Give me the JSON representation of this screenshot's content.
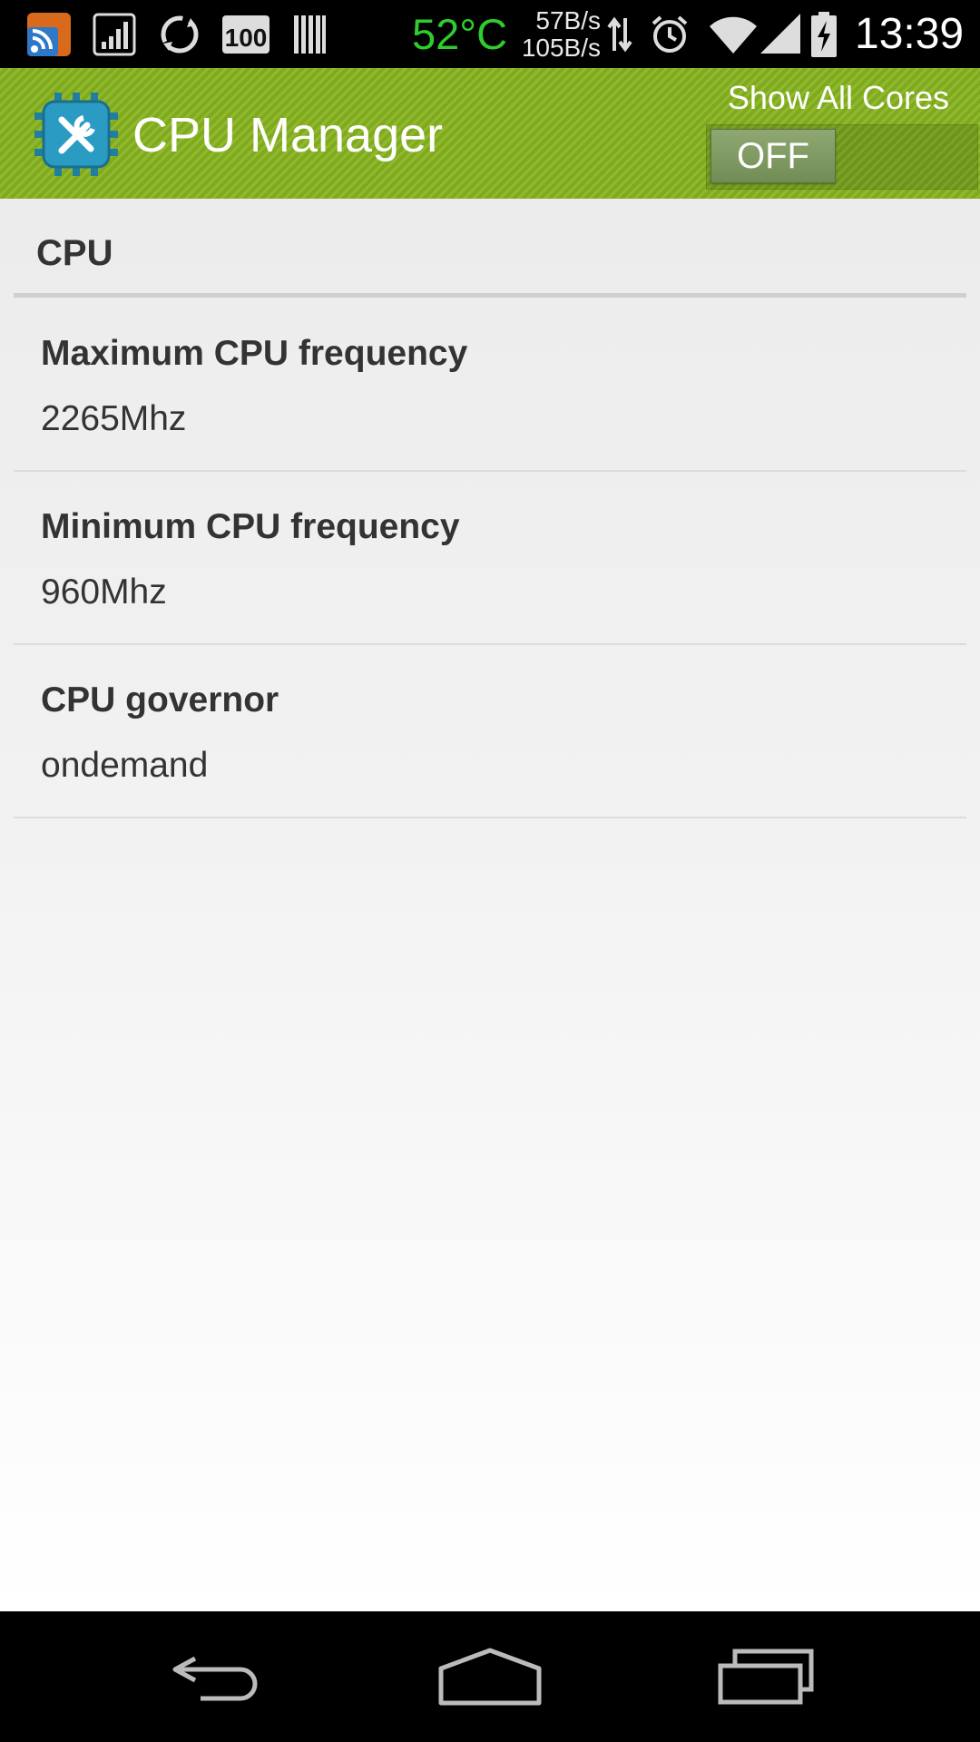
{
  "status_bar": {
    "temperature": "52°C",
    "upload_speed": "57B/s",
    "download_speed": "105B/s",
    "clock": "13:39",
    "icons": [
      "rss-app-icon",
      "signal-bars-app-icon",
      "sync-icon",
      "battery-100-icon",
      "barcode-icon",
      "data-arrows-icon",
      "alarm-icon",
      "wifi-icon",
      "cell-signal-icon",
      "battery-charging-icon"
    ]
  },
  "action_bar": {
    "title": "CPU Manager",
    "show_all_cores_label": "Show All Cores",
    "toggle_state": "OFF",
    "accent_color": "#87b31f",
    "icon": "cpu-tools-icon"
  },
  "section": {
    "header": "CPU"
  },
  "preferences": [
    {
      "title": "Maximum CPU frequency",
      "value": "2265Mhz"
    },
    {
      "title": "Minimum CPU frequency",
      "value": "960Mhz"
    },
    {
      "title": "CPU governor",
      "value": "ondemand"
    }
  ],
  "nav_bar": {
    "icons": [
      "back-icon",
      "home-icon",
      "recent-apps-icon"
    ]
  }
}
